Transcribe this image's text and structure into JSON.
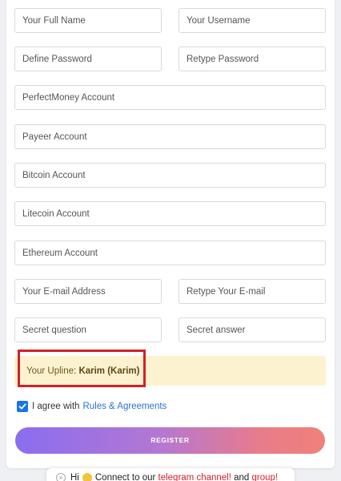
{
  "form": {
    "full_name_placeholder": "Your Full Name",
    "username_placeholder": "Your Username",
    "password_placeholder": "Define Password",
    "retype_password_placeholder": "Retype Password",
    "perfectmoney_placeholder": "PerfectMoney Account",
    "payeer_placeholder": "Payeer Account",
    "bitcoin_placeholder": "Bitcoin Account",
    "litecoin_placeholder": "Litecoin Account",
    "ethereum_placeholder": "Ethereum Account",
    "email_placeholder": "Your E-mail Address",
    "retype_email_placeholder": "Retype Your E-mail",
    "secret_question_placeholder": "Secret question",
    "secret_answer_placeholder": "Secret answer"
  },
  "upline": {
    "label": "Your Upline:",
    "name": "Karim (Karim)"
  },
  "agree": {
    "text": "I agree with",
    "link": "Rules & Agreements",
    "checked": true
  },
  "register": {
    "label": "REGISTER"
  },
  "notice": {
    "greeting": "Hi",
    "text_1": "Connect to our",
    "link_1": "telegram channel!",
    "text_2": "and",
    "link_2": "group!"
  },
  "colors": {
    "checkbox": "#1a73e8",
    "link": "#2a72c9",
    "upline_bg": "#fdf2cf",
    "highlight": "#d32027",
    "register_start": "#8a6df0",
    "register_end": "#f08079"
  }
}
